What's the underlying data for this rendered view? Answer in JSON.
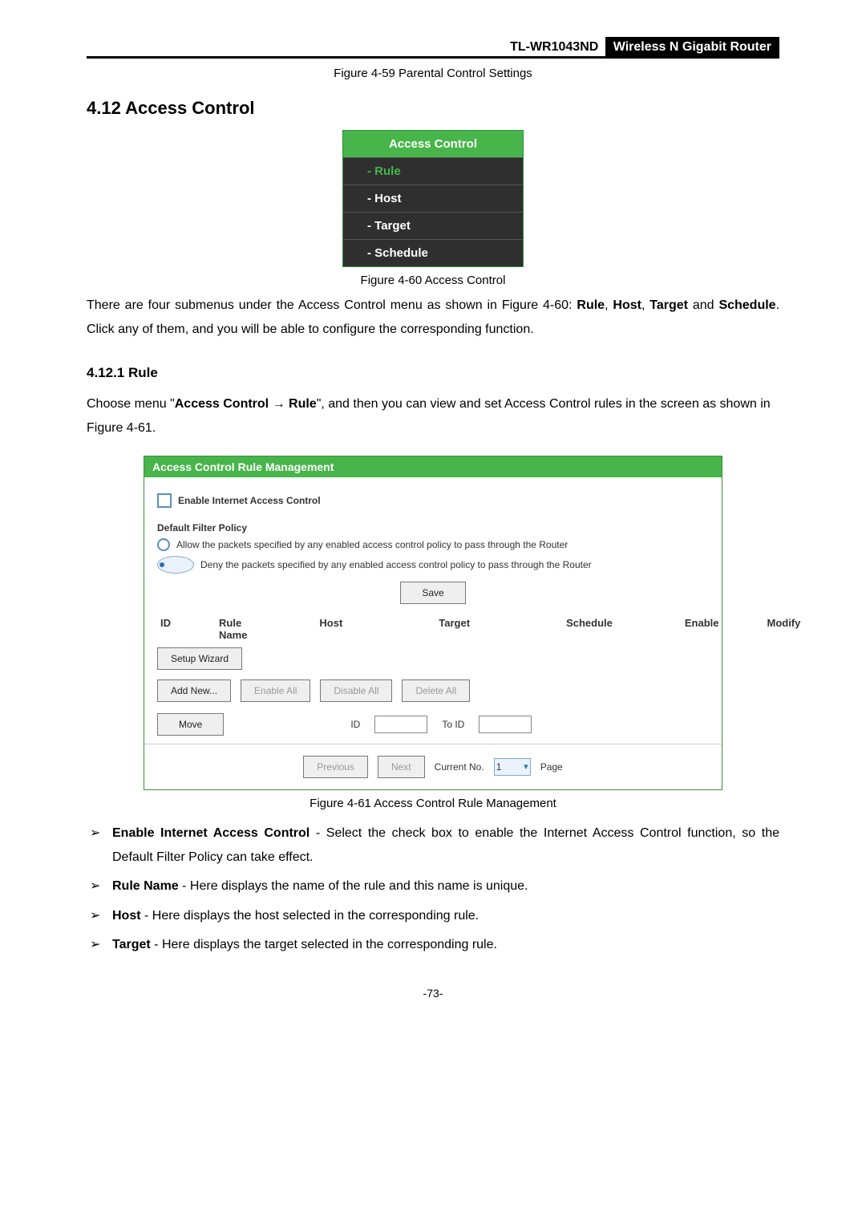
{
  "header": {
    "model": "TL-WR1043ND",
    "product": "Wireless N Gigabit Router"
  },
  "fig59": "Figure 4-59    Parental Control Settings",
  "sec": "4.12  Access Control",
  "menu": {
    "head": "Access Control",
    "items": [
      "- Rule",
      "- Host",
      "- Target",
      "- Schedule"
    ]
  },
  "fig60": "Figure 4-60    Access Control",
  "intro": {
    "pre": "There are four submenus under the Access Control menu as shown in Figure 4-60: ",
    "r": "Rule",
    "h": "Host",
    "t": "Target",
    "s": "Schedule",
    "post": ". Click any of them, and you will be able to configure the corresponding function."
  },
  "sub": "4.12.1  Rule",
  "rulepara": {
    "pre": "Choose menu \"",
    "ac": "Access Control",
    "arrow": " → ",
    "rule": "Rule",
    "post": "\", and then you can view and set Access Control rules in the screen as shown in Figure 4-61."
  },
  "panel": {
    "title": "Access Control Rule Management",
    "enable_label": "Enable Internet Access Control",
    "policy_label": "Default Filter Policy",
    "allow": "Allow the packets specified by any enabled access control policy to pass through the Router",
    "deny": "Deny the packets specified by any enabled access control policy to pass through the Router",
    "save": "Save",
    "cols": {
      "id": "ID",
      "name": "Rule Name",
      "host": "Host",
      "target": "Target",
      "sched": "Schedule",
      "enable": "Enable",
      "modify": "Modify"
    },
    "setup": "Setup Wizard",
    "add": "Add New...",
    "enall": "Enable All",
    "disall": "Disable All",
    "delall": "Delete All",
    "move": "Move",
    "idlbl": "ID",
    "toid": "To ID",
    "prev": "Previous",
    "next": "Next",
    "cur": "Current No.",
    "page": "Page",
    "one": "1"
  },
  "fig61": "Figure 4-61    Access Control Rule Management",
  "bullets": [
    {
      "b": "Enable Internet Access Control",
      "t": " - Select the check box to enable the Internet Access Control function, so the Default Filter Policy can take effect."
    },
    {
      "b": "Rule Name",
      "t": " - Here displays the name of the rule and this name is unique."
    },
    {
      "b": "Host",
      "t": " - Here displays the host selected in the corresponding rule."
    },
    {
      "b": "Target",
      "t": " - Here displays the target selected in the corresponding rule."
    }
  ],
  "pagenum": "-73-"
}
